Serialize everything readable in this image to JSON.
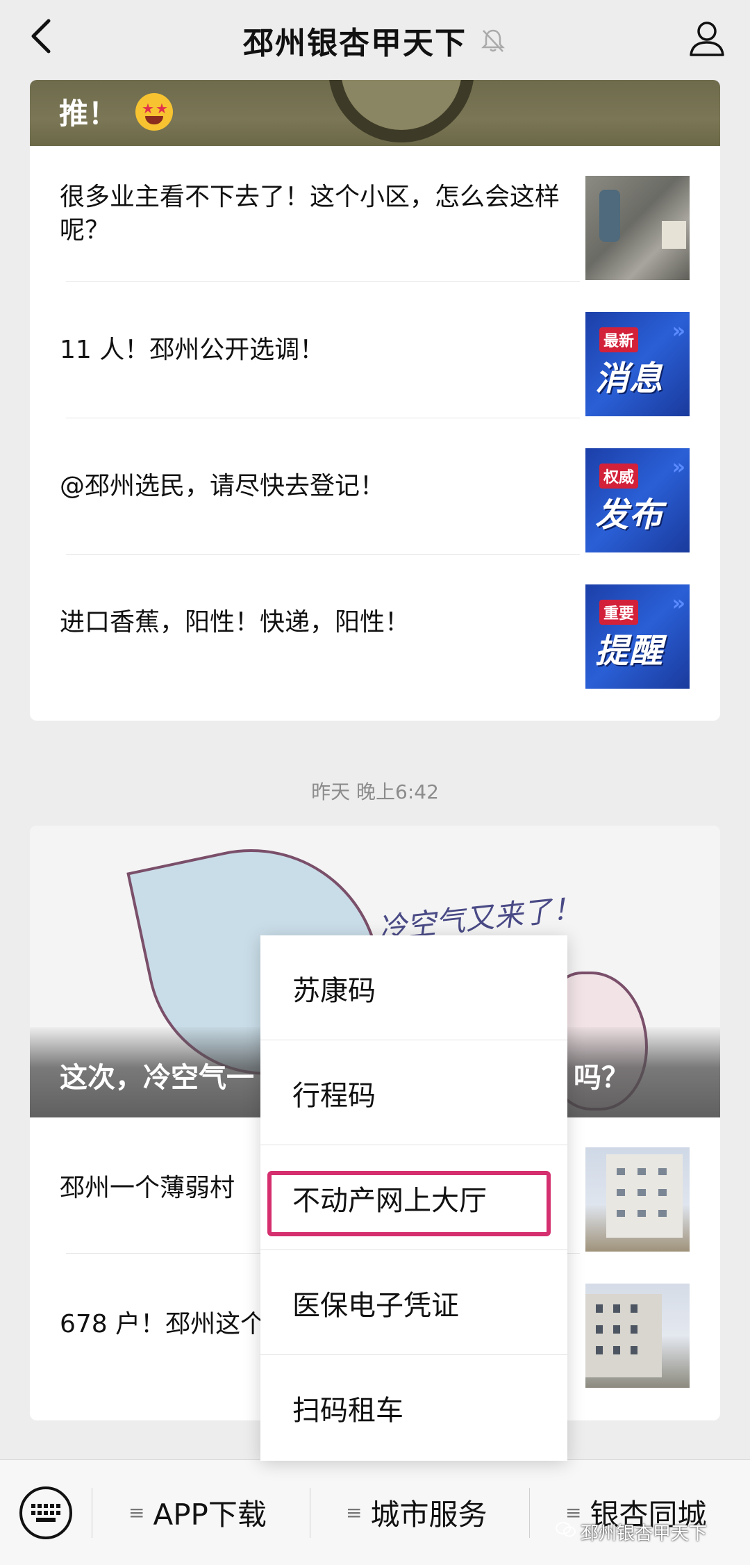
{
  "header": {
    "title": "邳州银杏甲天下",
    "back_icon": "chevron-left-icon",
    "mute_icon": "bell-muted-icon",
    "profile_icon": "person-icon"
  },
  "article_group_1": {
    "banner_text": "推！",
    "items": [
      {
        "title": "很多业主看不下去了！这个小区，怎么会这样呢？"
      },
      {
        "title": "11 人！邳州公开选调！",
        "thumb_tag": "最新",
        "thumb_big": "消息"
      },
      {
        "title": "@邳州选民，请尽快去登记！",
        "thumb_tag": "权威",
        "thumb_big": "发布"
      },
      {
        "title": "进口香蕉，阳性！快递，阳性！",
        "thumb_tag": "重要",
        "thumb_big": "提醒"
      }
    ]
  },
  "timestamp": "昨天 晚上6:42",
  "article_group_2": {
    "cover_scribble": "冷空气又来了！",
    "cover_caption_left": "这次，冷空气一",
    "cover_caption_right": "吗？",
    "items": [
      {
        "title": "邳州一个薄弱村"
      },
      {
        "title": "678 户！邳州这个"
      }
    ]
  },
  "popup_menu": {
    "items": [
      "苏康码",
      "行程码",
      "不动产网上大厅",
      "医保电子凭证",
      "扫码租车"
    ],
    "highlighted_index": 2,
    "highlight_color": "#d52f6f"
  },
  "bottom_bar": {
    "keyboard_icon": "keyboard-icon",
    "menus": [
      {
        "label": "APP下载"
      },
      {
        "label": "城市服务"
      },
      {
        "label": "银杏同城"
      }
    ]
  },
  "watermark": "邳州银杏甲天下"
}
